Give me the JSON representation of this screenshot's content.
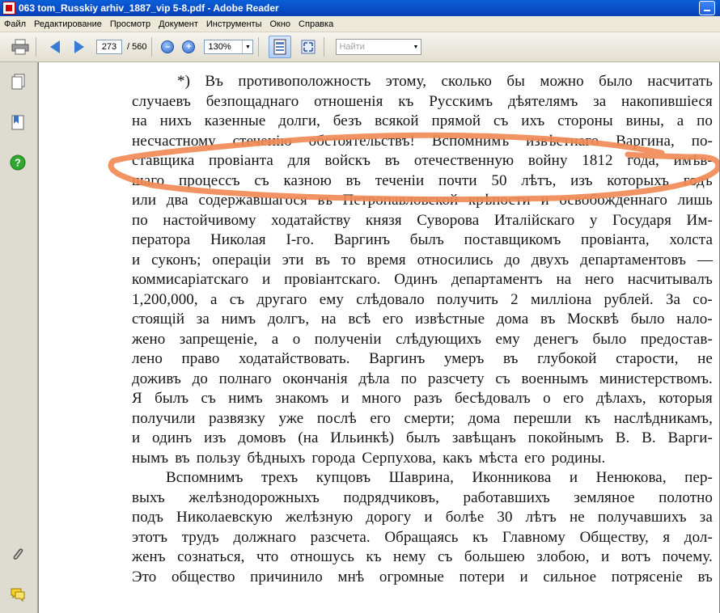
{
  "window": {
    "title": "063 tom_Russkiy arhiv_1887_vip 5-8.pdf - Adobe Reader"
  },
  "menu": [
    "Файл",
    "Редактирование",
    "Просмотр",
    "Документ",
    "Инструменты",
    "Окно",
    "Справка"
  ],
  "toolbar": {
    "page_current": "273",
    "page_total": "/ 560",
    "zoom": "130%",
    "find_placeholder": "Найти"
  },
  "icons": {
    "print": "printer-icon",
    "prev": "arrow-left-icon",
    "next": "arrow-right-icon",
    "zoom_out": "zoom-out-icon",
    "zoom_in": "zoom-in-icon",
    "fit_page": "fit-page-icon",
    "fullscreen": "fullscreen-icon",
    "sidebar": [
      "pages-icon",
      "bookmarks-icon",
      "help-icon",
      "attachments-icon",
      "comments-icon"
    ]
  },
  "colors": {
    "titlebar": "#0a5fd8",
    "highlight_scribble": "#f08a55"
  },
  "document": {
    "lines": [
      "*) Въ противоположность этому, сколько бы можно было насчитать",
      "случаевъ безпощаднаго отношенія къ Русскимъ дѣятелямъ за накопившіеся",
      "на нихъ казенные долги, безъ всякой прямой съ ихъ стороны вины, а по",
      "несчастному стеченію обстоятельствъ! Вспомнимъ извѣстнаго Варгина, по-",
      "ставщика провіанта для войскъ въ отечественную войну 1812 года, имѣв-",
      "шаго процессъ съ казною въ теченіи почти 50 лѣтъ, изъ которыхъ годъ",
      "или два содержавшагося въ Петропавловской крѣпости и освобожденнаго лишь",
      "по настойчивому ходатайству князя Суворова Италійскаго у Государя Им-",
      "ператора Николая I-го. Варгинъ былъ поставщикомъ провіанта, холста",
      "и суконъ; операціи эти въ то время относились до двухъ департаментовъ —",
      "коммисаріатскаго и провіантскаго. Одинъ департаментъ на него насчитывалъ",
      "1,200,000, а съ другаго ему слѣдовало получить 2 милліона рублей. За со-",
      "стоящій за нимъ долгъ, на всѣ его извѣстные дома въ Москвѣ было нало-",
      "жено запрещеніе, а о полученіи слѣдующихъ ему денегъ было предостав-",
      "лено право ходатайствовать. Варгинъ умеръ въ глубокой старости, не",
      "доживъ до полнаго окончанія дѣла по разсчету съ военнымъ министерствомъ.",
      "Я былъ съ нимъ знакомъ и много разъ бесѣдовалъ о его дѣлахъ, которыя",
      "получили развязку уже послѣ его смерти; дома перешли къ наслѣдникамъ,",
      "и одинъ изъ домовъ (на Ильинкѣ) былъ завѣщанъ покойнымъ В. В. Варги-",
      "нымъ въ пользу бѣдныхъ города Серпухова, какъ мѣста его родины.",
      "Вспомнимъ трехъ купцовъ Шаврина, Иконникова и Ненюкова, пер-",
      "выхъ желѣзнодорожныхъ подрядчиковъ, работавшихъ земляное полотно",
      "подъ Николаевскую желѣзную дорогу и болѣе 30 лѣтъ не получавшихъ за",
      "этотъ трудъ должнаго разсчета. Обращаясь къ Главному Обществу, я дол-",
      "женъ сознаться, что отношусь къ нему съ большею злобою, и вотъ почему.",
      "Это общество причинило мнѣ огромные потери и сильное потрясеніе въ"
    ]
  }
}
